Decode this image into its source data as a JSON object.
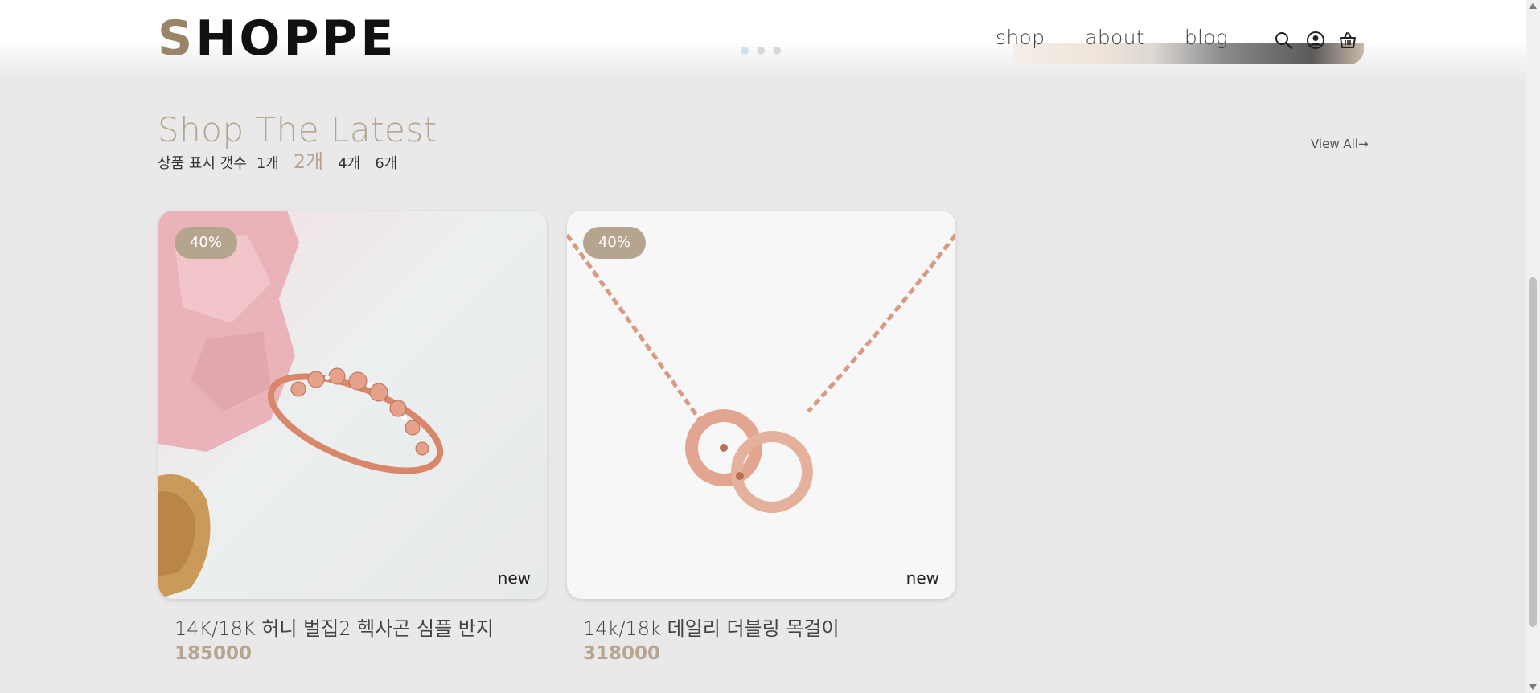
{
  "header": {
    "logo_first": "S",
    "logo_rest": "HOPPE",
    "nav": [
      "shop",
      "about",
      "blog"
    ],
    "icons": [
      "search-icon",
      "user-icon",
      "cart-icon"
    ]
  },
  "section": {
    "title": "Shop The Latest",
    "count_label": "상품 표시 갯수",
    "count_options": [
      "1개",
      "2개",
      "4개",
      "6개"
    ],
    "count_selected": "2개",
    "view_all": "View All→"
  },
  "products": [
    {
      "badge": "40%",
      "tag": "new",
      "name": "14K/18K 허니 벌집2 헥사곤 심플 반지",
      "price": "185000"
    },
    {
      "badge": "40%",
      "tag": "new",
      "name": "14k/18k 데일리 더블링 목걸이",
      "price": "318000"
    }
  ],
  "colors": {
    "accent": "#b5a591",
    "badge": "#b5a58e",
    "background": "#e9e9e9"
  }
}
